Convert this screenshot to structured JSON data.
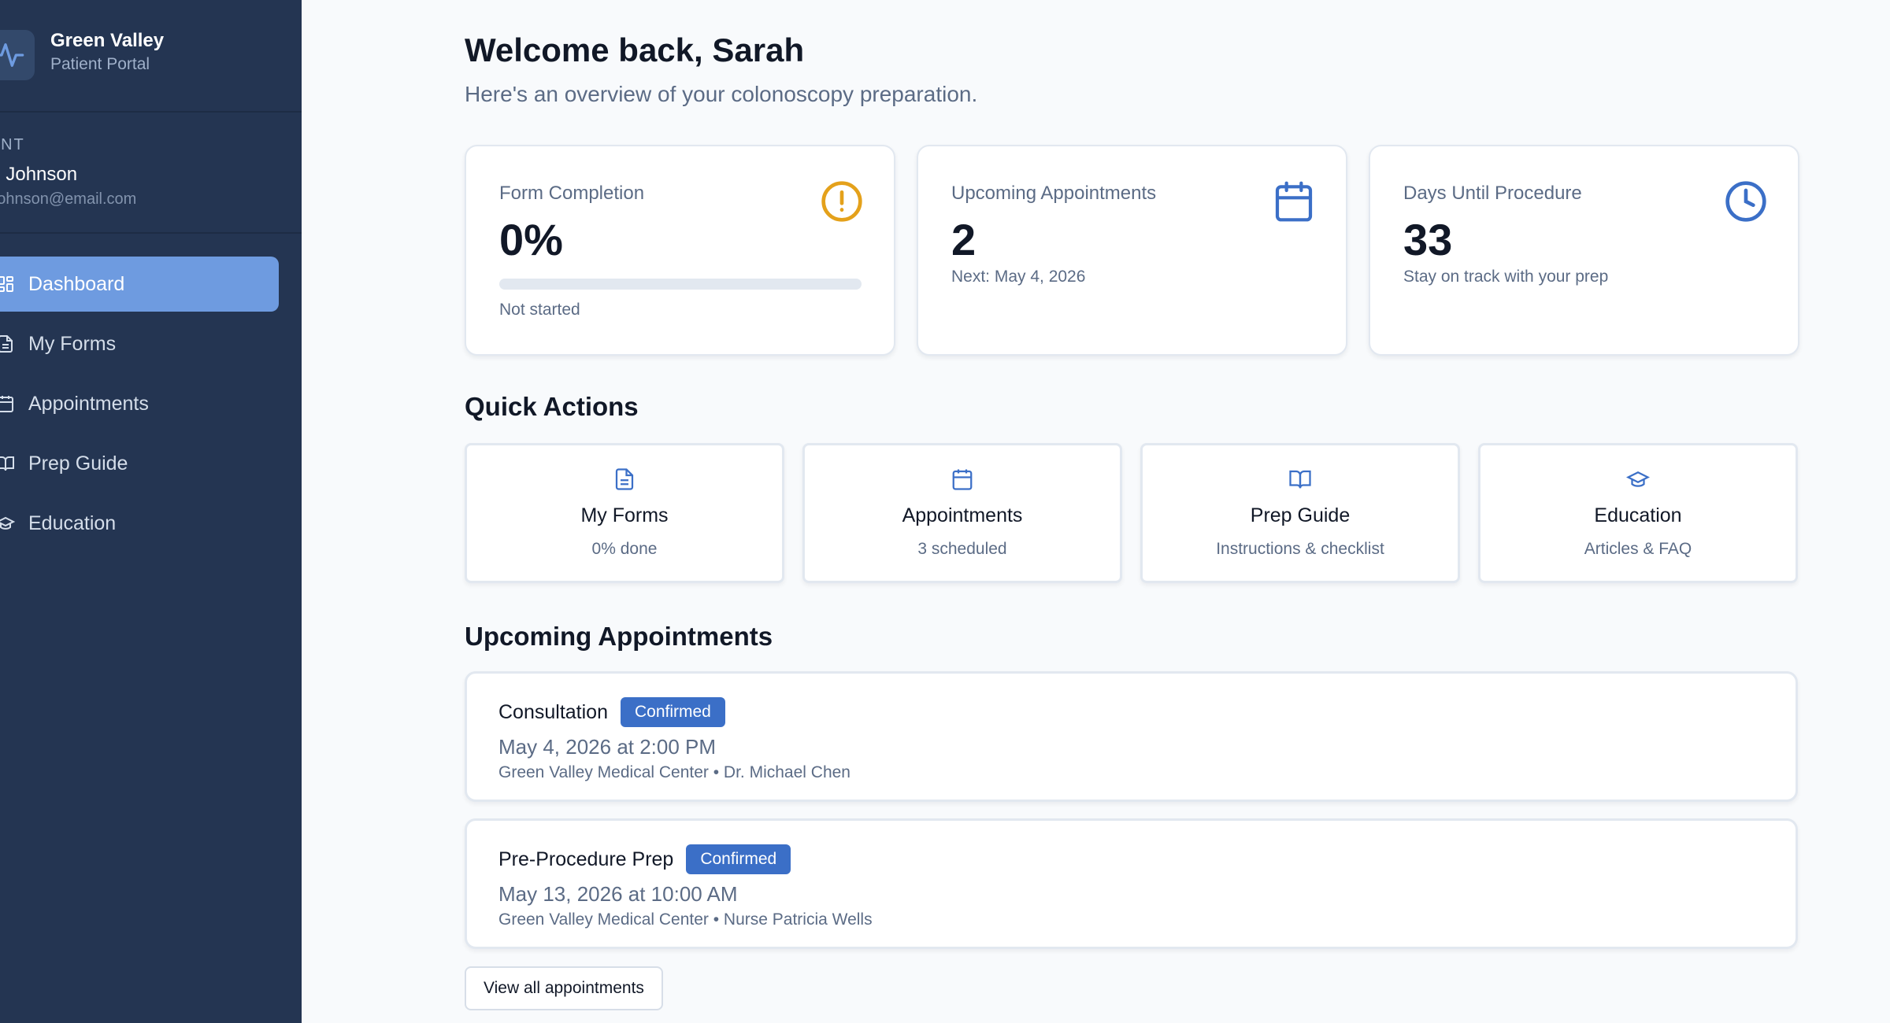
{
  "brand": {
    "name": "Green Valley",
    "subtitle": "Patient Portal",
    "icon": "pulse-icon"
  },
  "patient": {
    "label": "TIENT",
    "name": "rah Johnson",
    "email": "ah.johnson@email.com"
  },
  "nav": {
    "items": [
      {
        "label": "Dashboard",
        "icon": "dashboard-icon",
        "active": true
      },
      {
        "label": "My Forms",
        "icon": "document-icon",
        "active": false
      },
      {
        "label": "Appointments",
        "icon": "calendar-icon",
        "active": false
      },
      {
        "label": "Prep Guide",
        "icon": "book-icon",
        "active": false
      },
      {
        "label": "Education",
        "icon": "graduation-cap-icon",
        "active": false
      }
    ]
  },
  "header": {
    "welcome": "Welcome back, Sarah",
    "subtitle": "Here's an overview of your colonoscopy preparation."
  },
  "stats": {
    "form_completion": {
      "title": "Form Completion",
      "value": "0%",
      "progress": 0,
      "status": "Not started",
      "icon": "alert-circle-icon",
      "color": "#e4a11b"
    },
    "upcoming_appointments": {
      "title": "Upcoming Appointments",
      "value": "2",
      "sub": "Next: May 4, 2026",
      "icon": "calendar-icon",
      "color": "#3b6fc7"
    },
    "days_until": {
      "title": "Days Until Procedure",
      "value": "33",
      "sub": "Stay on track with your prep",
      "icon": "clock-icon",
      "color": "#3b6fc7"
    }
  },
  "quick_actions": {
    "title": "Quick Actions",
    "items": [
      {
        "title": "My Forms",
        "sub": "0% done",
        "icon": "document-icon"
      },
      {
        "title": "Appointments",
        "sub": "3 scheduled",
        "icon": "calendar-icon"
      },
      {
        "title": "Prep Guide",
        "sub": "Instructions & checklist",
        "icon": "book-icon"
      },
      {
        "title": "Education",
        "sub": "Articles & FAQ",
        "icon": "graduation-cap-icon"
      }
    ]
  },
  "appointments": {
    "title": "Upcoming Appointments",
    "items": [
      {
        "name": "Consultation",
        "status": "Confirmed",
        "date": "May 4, 2026 at 2:00 PM",
        "location": "Green Valley Medical Center • Dr. Michael Chen"
      },
      {
        "name": "Pre-Procedure Prep",
        "status": "Confirmed",
        "date": "May 13, 2026 at 10:00 AM",
        "location": "Green Valley Medical Center • Nurse Patricia Wells"
      }
    ],
    "view_all_label": "View all appointments"
  },
  "colors": {
    "sidebar": "#243552",
    "active_nav": "#6e9be0",
    "accent": "#3b6fc7",
    "warning": "#e4a11b"
  }
}
